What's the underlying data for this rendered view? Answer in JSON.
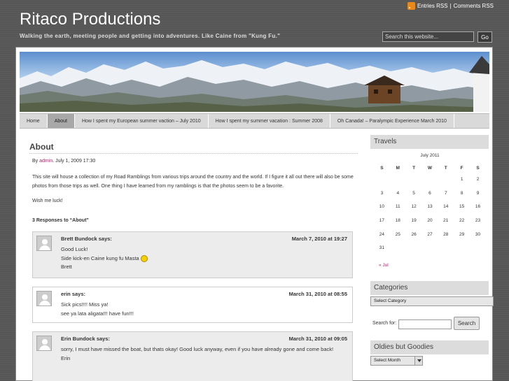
{
  "header": {
    "rss_entries": "Entries RSS",
    "rss_sep": "|",
    "rss_comments": "Comments RSS",
    "title": "Ritaco Productions",
    "tagline": "Walking the earth, meeting people and getting into adventures. Like Caine from \"Kung Fu.\"",
    "search_placeholder": "Search this website...",
    "search_button": "Go"
  },
  "nav": {
    "items": [
      {
        "label": "Home"
      },
      {
        "label": "About",
        "active": true
      },
      {
        "label": "How I spent my European summer vaction – July 2010"
      },
      {
        "label": "How I spent my summer vacation : Summer 2008"
      },
      {
        "label": "Oh Canada! – Paralympic Experience March 2010"
      }
    ]
  },
  "post": {
    "title": "About",
    "meta_prefix": "By",
    "author": "admin",
    "date": ". July 1, 2009 17:30",
    "paragraphs": [
      "This site will house a collection of my Road Ramblings from various trips around the country and the world.  If I figure it all out there will also be some photos from those trips as well.  One thing I have learned from my ramblings is that the photos seem to be a favorite.",
      "Wish me luck!"
    ],
    "responses_heading": "3 Responses to “About”"
  },
  "comments": [
    {
      "author": "Brett Bundock says:",
      "date": "March 7, 2010 at 19:27",
      "lines": [
        "Good Luck!",
        "Side kick-en Caine kung fu Masta",
        "Brett"
      ]
    },
    {
      "author": "erin says:",
      "date": "March 31, 2010 at 08:55",
      "lines": [
        "Sick pics!!!! Miss ya!",
        "see ya lata aligata!!! have fun!!!"
      ]
    },
    {
      "author": "Erin Bundock says:",
      "date": "March 31, 2010 at 09:05",
      "lines": [
        "sorry, I must have missed the boat, but thats okay! Good luck anyway, even if you have already gone and come back!",
        "Erin"
      ]
    }
  ],
  "sidebar": {
    "travels_title": "Travels",
    "calendar": {
      "caption": "July 2011",
      "weekdays": [
        "S",
        "M",
        "T",
        "W",
        "T",
        "F",
        "S"
      ],
      "weeks": [
        [
          "",
          "",
          "",
          "",
          "",
          "1",
          "2"
        ],
        [
          "3",
          "4",
          "5",
          "6",
          "7",
          "8",
          "9"
        ],
        [
          "10",
          "11",
          "12",
          "13",
          "14",
          "15",
          "16"
        ],
        [
          "17",
          "18",
          "19",
          "20",
          "21",
          "22",
          "23"
        ],
        [
          "24",
          "25",
          "26",
          "27",
          "28",
          "29",
          "30"
        ],
        [
          "31",
          "",
          "",
          "",
          "",
          "",
          ""
        ]
      ],
      "prev_link": "« Jul"
    },
    "categories_title": "Categories",
    "categories_select": "Select Category",
    "search_label": "Search for:",
    "search_button": "Search",
    "archives_title": "Oldies but Goodies",
    "archives_select": "Select Month"
  },
  "colors": {
    "background": "#5a5a5a",
    "link": "#a0306a",
    "nav_active": "#a8a8a8",
    "rss_icon": "#e8891c"
  }
}
